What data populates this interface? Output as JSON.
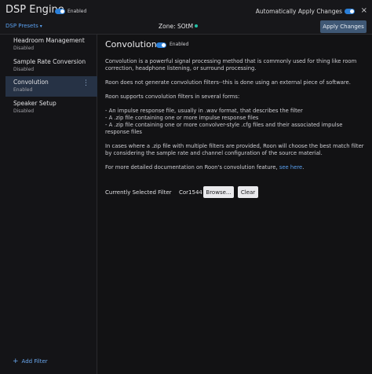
{
  "header": {
    "title": "DSP Engine",
    "engine_status": "Enabled",
    "auto_apply_label": "Automatically Apply Changes",
    "close_icon": "×",
    "presets_label": "DSP Presets",
    "presets_caret": "▾",
    "zone_label": "Zone: SOtM",
    "apply_label": "Apply Changes"
  },
  "sidebar": {
    "items": [
      {
        "name": "Headroom Management",
        "status": "Disabled"
      },
      {
        "name": "Sample Rate Conversion",
        "status": "Disabled"
      },
      {
        "name": "Convolution",
        "status": "Enabled"
      },
      {
        "name": "Speaker Setup",
        "status": "Disabled"
      }
    ],
    "kebab": "⋮",
    "add_icon": "+",
    "add_label": "Add Filter"
  },
  "main": {
    "title": "Convolution",
    "status": "Enabled",
    "p1": "Convolution is a powerful signal processing method that is commonly used for thing like room correction, headphone listening, or surround processing.",
    "p2": "Roon does not generate convolution filters--this is done using an external piece of software.",
    "p3": "Roon supports convolution filters in several forms:",
    "b1": "- An impulse response file, usually in .wav format, that describes the filter",
    "b2": "- A .zip file containing one or more impulse response files",
    "b3": "- A .zip file containing one or more convolver-style .cfg files and their associated impulse response files",
    "p4": "In cases where a .zip file with multiple filters are provided, Roon will choose the best match filter by considering the sample rate and channel configuration of the source material.",
    "p5_prefix": "For more detailed documentation on Roon's convolution feature,",
    "p5_link": "see here",
    "p5_suffix": ".",
    "selected_label": "Currently Selected Filter",
    "selected_value": "Cor1544",
    "browse_label": "Browse...",
    "clear_label": "Clear"
  },
  "colors": {
    "accent": "#2b7fd8",
    "link": "#5aa0f0",
    "zone_dot": "#22c0a6",
    "active_item": "#263245"
  }
}
